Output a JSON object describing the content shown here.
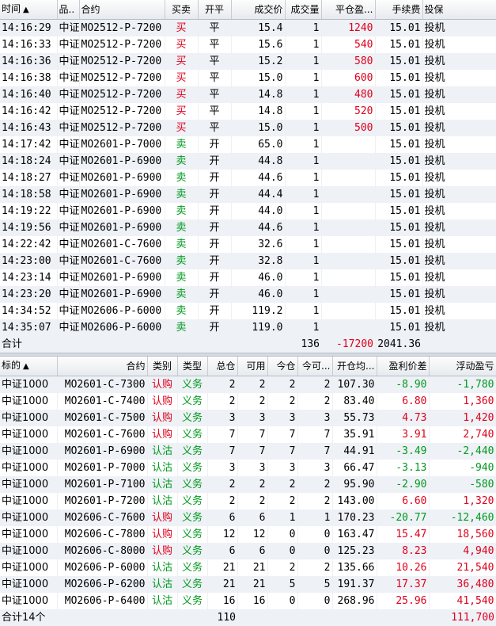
{
  "trades": {
    "headers": [
      "时间",
      "品..",
      "合约",
      "买卖",
      "开平",
      "成交价",
      "成交量",
      "平仓盈...",
      "手续费",
      "投保"
    ],
    "sort_icon": "▲",
    "rows": [
      {
        "time": "14:16:29",
        "product": "中证",
        "contract": "MO2512-P-7200",
        "side": "买",
        "side_color": "red",
        "offset": "平",
        "price": "15.4",
        "qty": "1",
        "pnl": "1240",
        "fee": "15.01",
        "hedge": "投机"
      },
      {
        "time": "14:16:33",
        "product": "中证",
        "contract": "MO2512-P-7200",
        "side": "买",
        "side_color": "red",
        "offset": "平",
        "price": "15.6",
        "qty": "1",
        "pnl": "540",
        "fee": "15.01",
        "hedge": "投机"
      },
      {
        "time": "14:16:36",
        "product": "中证",
        "contract": "MO2512-P-7200",
        "side": "买",
        "side_color": "red",
        "offset": "平",
        "price": "15.2",
        "qty": "1",
        "pnl": "580",
        "fee": "15.01",
        "hedge": "投机"
      },
      {
        "time": "14:16:38",
        "product": "中证",
        "contract": "MO2512-P-7200",
        "side": "买",
        "side_color": "red",
        "offset": "平",
        "price": "15.0",
        "qty": "1",
        "pnl": "600",
        "fee": "15.01",
        "hedge": "投机"
      },
      {
        "time": "14:16:40",
        "product": "中证",
        "contract": "MO2512-P-7200",
        "side": "买",
        "side_color": "red",
        "offset": "平",
        "price": "14.8",
        "qty": "1",
        "pnl": "480",
        "fee": "15.01",
        "hedge": "投机"
      },
      {
        "time": "14:16:42",
        "product": "中证",
        "contract": "MO2512-P-7200",
        "side": "买",
        "side_color": "red",
        "offset": "平",
        "price": "14.8",
        "qty": "1",
        "pnl": "520",
        "fee": "15.01",
        "hedge": "投机"
      },
      {
        "time": "14:16:43",
        "product": "中证",
        "contract": "MO2512-P-7200",
        "side": "买",
        "side_color": "red",
        "offset": "平",
        "price": "15.0",
        "qty": "1",
        "pnl": "500",
        "fee": "15.01",
        "hedge": "投机"
      },
      {
        "time": "14:17:42",
        "product": "中证",
        "contract": "MO2601-P-7000",
        "side": "卖",
        "side_color": "green",
        "offset": "开",
        "price": "65.0",
        "qty": "1",
        "pnl": "",
        "fee": "15.01",
        "hedge": "投机"
      },
      {
        "time": "14:18:24",
        "product": "中证",
        "contract": "MO2601-P-6900",
        "side": "卖",
        "side_color": "green",
        "offset": "开",
        "price": "44.8",
        "qty": "1",
        "pnl": "",
        "fee": "15.01",
        "hedge": "投机"
      },
      {
        "time": "14:18:27",
        "product": "中证",
        "contract": "MO2601-P-6900",
        "side": "卖",
        "side_color": "green",
        "offset": "开",
        "price": "44.6",
        "qty": "1",
        "pnl": "",
        "fee": "15.01",
        "hedge": "投机"
      },
      {
        "time": "14:18:58",
        "product": "中证",
        "contract": "MO2601-P-6900",
        "side": "卖",
        "side_color": "green",
        "offset": "开",
        "price": "44.4",
        "qty": "1",
        "pnl": "",
        "fee": "15.01",
        "hedge": "投机"
      },
      {
        "time": "14:19:22",
        "product": "中证",
        "contract": "MO2601-P-6900",
        "side": "卖",
        "side_color": "green",
        "offset": "开",
        "price": "44.0",
        "qty": "1",
        "pnl": "",
        "fee": "15.01",
        "hedge": "投机"
      },
      {
        "time": "14:19:56",
        "product": "中证",
        "contract": "MO2601-P-6900",
        "side": "卖",
        "side_color": "green",
        "offset": "开",
        "price": "44.6",
        "qty": "1",
        "pnl": "",
        "fee": "15.01",
        "hedge": "投机"
      },
      {
        "time": "14:22:42",
        "product": "中证",
        "contract": "MO2601-C-7600",
        "side": "卖",
        "side_color": "green",
        "offset": "开",
        "price": "32.6",
        "qty": "1",
        "pnl": "",
        "fee": "15.01",
        "hedge": "投机"
      },
      {
        "time": "14:23:00",
        "product": "中证",
        "contract": "MO2601-C-7600",
        "side": "卖",
        "side_color": "green",
        "offset": "开",
        "price": "32.8",
        "qty": "1",
        "pnl": "",
        "fee": "15.01",
        "hedge": "投机"
      },
      {
        "time": "14:23:14",
        "product": "中证",
        "contract": "MO2601-P-6900",
        "side": "卖",
        "side_color": "green",
        "offset": "开",
        "price": "46.0",
        "qty": "1",
        "pnl": "",
        "fee": "15.01",
        "hedge": "投机"
      },
      {
        "time": "14:23:20",
        "product": "中证",
        "contract": "MO2601-P-6900",
        "side": "卖",
        "side_color": "green",
        "offset": "开",
        "price": "46.0",
        "qty": "1",
        "pnl": "",
        "fee": "15.01",
        "hedge": "投机"
      },
      {
        "time": "14:34:52",
        "product": "中证",
        "contract": "MO2606-P-6000",
        "side": "卖",
        "side_color": "green",
        "offset": "开",
        "price": "119.2",
        "qty": "1",
        "pnl": "",
        "fee": "15.01",
        "hedge": "投机"
      },
      {
        "time": "14:35:07",
        "product": "中证",
        "contract": "MO2606-P-6000",
        "side": "卖",
        "side_color": "green",
        "offset": "开",
        "price": "119.0",
        "qty": "1",
        "pnl": "",
        "fee": "15.01",
        "hedge": "投机"
      }
    ],
    "total": {
      "label": "合计",
      "qty": "136",
      "pnl": "-17200",
      "fee": "2041.36"
    }
  },
  "positions": {
    "headers": [
      "标的",
      "合约",
      "类别",
      "类型",
      "总仓",
      "可用",
      "今仓",
      "今可...",
      "开仓均...",
      "盈利价差",
      "浮动盈亏"
    ],
    "sort_icon": "▲",
    "rows": [
      {
        "underlying": "中证1000",
        "contract": "MO2601-C-7300",
        "category": "认购",
        "category_color": "red",
        "type": "义务",
        "total": "2",
        "avail": "2",
        "today": "2",
        "today_avail": "2",
        "avg": "107.30",
        "spread": "-8.90",
        "spread_color": "green",
        "pnl": "-1,780",
        "pnl_color": "green"
      },
      {
        "underlying": "中证1000",
        "contract": "MO2601-C-7400",
        "category": "认购",
        "category_color": "red",
        "type": "义务",
        "total": "2",
        "avail": "2",
        "today": "2",
        "today_avail": "2",
        "avg": "83.40",
        "spread": "6.80",
        "spread_color": "red",
        "pnl": "1,360",
        "pnl_color": "red"
      },
      {
        "underlying": "中证1000",
        "contract": "MO2601-C-7500",
        "category": "认购",
        "category_color": "red",
        "type": "义务",
        "total": "3",
        "avail": "3",
        "today": "3",
        "today_avail": "3",
        "avg": "55.73",
        "spread": "4.73",
        "spread_color": "red",
        "pnl": "1,420",
        "pnl_color": "red"
      },
      {
        "underlying": "中证1000",
        "contract": "MO2601-C-7600",
        "category": "认购",
        "category_color": "red",
        "type": "义务",
        "total": "7",
        "avail": "7",
        "today": "7",
        "today_avail": "7",
        "avg": "35.91",
        "spread": "3.91",
        "spread_color": "red",
        "pnl": "2,740",
        "pnl_color": "red"
      },
      {
        "underlying": "中证1000",
        "contract": "MO2601-P-6900",
        "category": "认沽",
        "category_color": "green",
        "type": "义务",
        "total": "7",
        "avail": "7",
        "today": "7",
        "today_avail": "7",
        "avg": "44.91",
        "spread": "-3.49",
        "spread_color": "green",
        "pnl": "-2,440",
        "pnl_color": "green"
      },
      {
        "underlying": "中证1000",
        "contract": "MO2601-P-7000",
        "category": "认沽",
        "category_color": "green",
        "type": "义务",
        "total": "3",
        "avail": "3",
        "today": "3",
        "today_avail": "3",
        "avg": "66.47",
        "spread": "-3.13",
        "spread_color": "green",
        "pnl": "-940",
        "pnl_color": "green"
      },
      {
        "underlying": "中证1000",
        "contract": "MO2601-P-7100",
        "category": "认沽",
        "category_color": "green",
        "type": "义务",
        "total": "2",
        "avail": "2",
        "today": "2",
        "today_avail": "2",
        "avg": "95.90",
        "spread": "-2.90",
        "spread_color": "green",
        "pnl": "-580",
        "pnl_color": "green"
      },
      {
        "underlying": "中证1000",
        "contract": "MO2601-P-7200",
        "category": "认沽",
        "category_color": "green",
        "type": "义务",
        "total": "2",
        "avail": "2",
        "today": "2",
        "today_avail": "2",
        "avg": "143.00",
        "spread": "6.60",
        "spread_color": "red",
        "pnl": "1,320",
        "pnl_color": "red"
      },
      {
        "underlying": "中证1000",
        "contract": "MO2606-C-7600",
        "category": "认购",
        "category_color": "red",
        "type": "义务",
        "total": "6",
        "avail": "6",
        "today": "1",
        "today_avail": "1",
        "avg": "170.23",
        "spread": "-20.77",
        "spread_color": "green",
        "pnl": "-12,460",
        "pnl_color": "green"
      },
      {
        "underlying": "中证1000",
        "contract": "MO2606-C-7800",
        "category": "认购",
        "category_color": "red",
        "type": "义务",
        "total": "12",
        "avail": "12",
        "today": "0",
        "today_avail": "0",
        "avg": "163.47",
        "spread": "15.47",
        "spread_color": "red",
        "pnl": "18,560",
        "pnl_color": "red"
      },
      {
        "underlying": "中证1000",
        "contract": "MO2606-C-8000",
        "category": "认购",
        "category_color": "red",
        "type": "义务",
        "total": "6",
        "avail": "6",
        "today": "0",
        "today_avail": "0",
        "avg": "125.23",
        "spread": "8.23",
        "spread_color": "red",
        "pnl": "4,940",
        "pnl_color": "red"
      },
      {
        "underlying": "中证1000",
        "contract": "MO2606-P-6000",
        "category": "认沽",
        "category_color": "green",
        "type": "义务",
        "total": "21",
        "avail": "21",
        "today": "2",
        "today_avail": "2",
        "avg": "135.66",
        "spread": "10.26",
        "spread_color": "red",
        "pnl": "21,540",
        "pnl_color": "red"
      },
      {
        "underlying": "中证1000",
        "contract": "MO2606-P-6200",
        "category": "认沽",
        "category_color": "green",
        "type": "义务",
        "total": "21",
        "avail": "21",
        "today": "5",
        "today_avail": "5",
        "avg": "191.37",
        "spread": "17.37",
        "spread_color": "red",
        "pnl": "36,480",
        "pnl_color": "red"
      },
      {
        "underlying": "中证1000",
        "contract": "MO2606-P-6400",
        "category": "认沽",
        "category_color": "green",
        "type": "义务",
        "total": "16",
        "avail": "16",
        "today": "0",
        "today_avail": "0",
        "avg": "268.96",
        "spread": "25.96",
        "spread_color": "red",
        "pnl": "41,540",
        "pnl_color": "red"
      }
    ],
    "total": {
      "label": "合计14个",
      "total": "110",
      "pnl": "111,700",
      "pnl_color": "red"
    }
  }
}
